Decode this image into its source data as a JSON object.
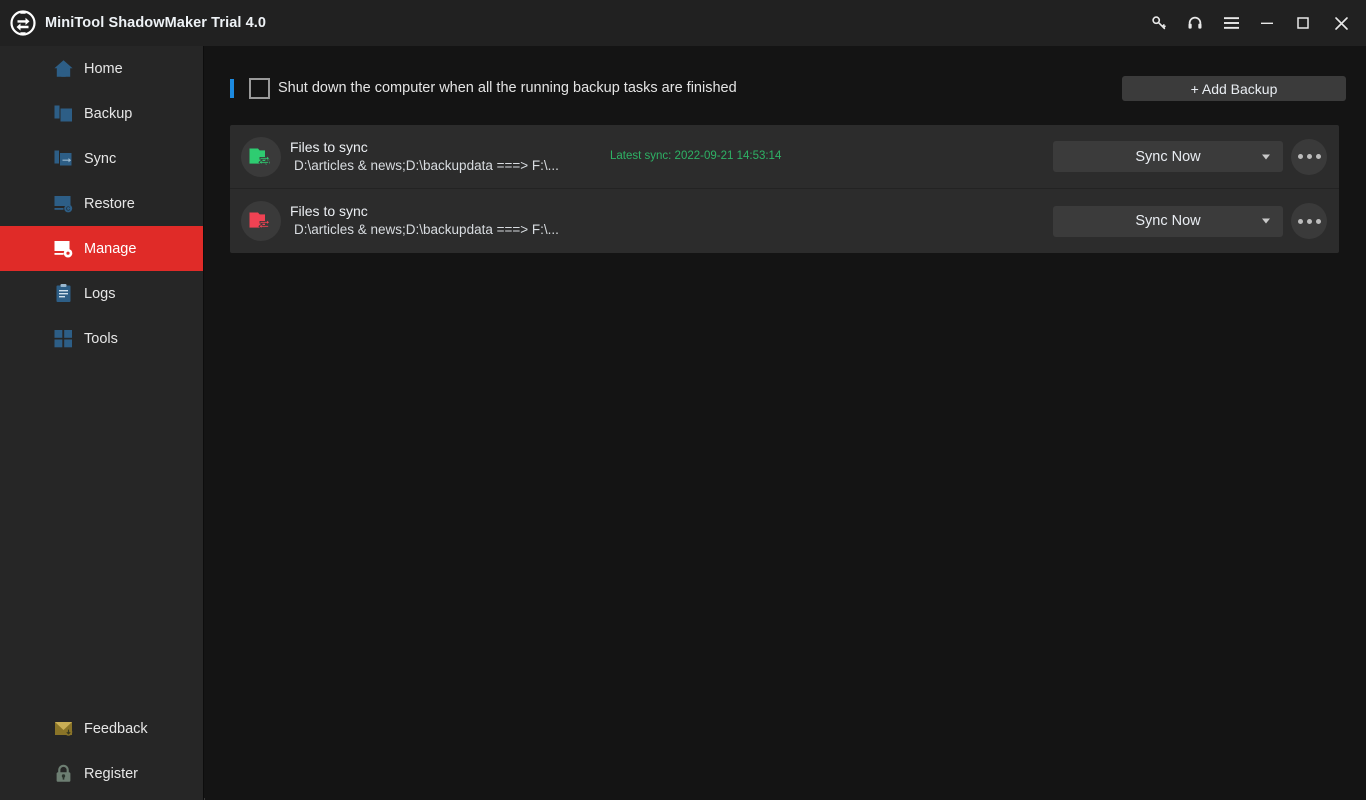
{
  "window": {
    "title": "MiniTool ShadowMaker Trial 4.0",
    "logo_icon": "minitool-sync-logo-icon",
    "controls": [
      {
        "name": "key-icon",
        "label": "Key"
      },
      {
        "name": "headset-icon",
        "label": "Support"
      },
      {
        "name": "hamburger-icon",
        "label": "Menu"
      },
      {
        "name": "minimize-icon",
        "label": "Minimize"
      },
      {
        "name": "maximize-icon",
        "label": "Maximize"
      },
      {
        "name": "close-icon",
        "label": "Close"
      }
    ]
  },
  "colors": {
    "titlebar_bg": "#212121",
    "sidebar_bg": "#262626",
    "main_bg": "#141414",
    "card_bg": "#2c2c2c",
    "accent_red": "#e02b28",
    "accent_blue": "#1c8ae0",
    "sync_green": "#2eb265",
    "task_red": "#f04253",
    "button_bg": "#3b3b3b"
  },
  "sidebar": {
    "items": [
      {
        "label": "Home",
        "icon": "home-icon",
        "active": false
      },
      {
        "label": "Backup",
        "icon": "backup-icon",
        "active": false
      },
      {
        "label": "Sync",
        "icon": "sync-icon",
        "active": false
      },
      {
        "label": "Restore",
        "icon": "restore-icon",
        "active": false
      },
      {
        "label": "Manage",
        "icon": "manage-icon",
        "active": true
      },
      {
        "label": "Logs",
        "icon": "logs-icon",
        "active": false
      },
      {
        "label": "Tools",
        "icon": "tools-icon",
        "active": false
      }
    ],
    "bottom_items": [
      {
        "label": "Feedback",
        "icon": "feedback-envelope-icon"
      },
      {
        "label": "Register",
        "icon": "register-lock-icon"
      }
    ]
  },
  "toolbar": {
    "shutdown_label": "Shut down the computer when all the running backup tasks are finished",
    "shutdown_checked": false,
    "add_backup_label": "+ Add Backup"
  },
  "tasks": [
    {
      "title": "Files to sync",
      "path": "D:\\articles & news;D:\\backupdata ===> F:\\...",
      "latest_sync": "Latest sync: 2022-09-21 14:53:14",
      "icon": "folder-sync-icon",
      "icon_color": "#2ecc71",
      "action_label": "Sync Now"
    },
    {
      "title": "Files to sync",
      "path": "D:\\articles & news;D:\\backupdata ===> F:\\...",
      "latest_sync": "",
      "icon": "folder-sync-icon",
      "icon_color": "#f04253",
      "action_label": "Sync Now"
    }
  ]
}
